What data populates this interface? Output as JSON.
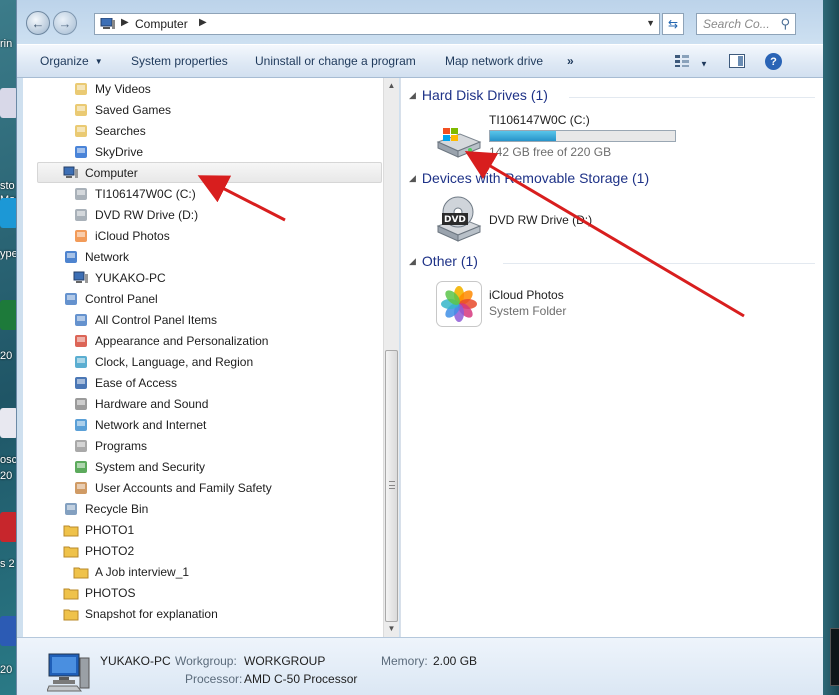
{
  "window": {
    "address": {
      "crumb": "Computer"
    },
    "search": {
      "placeholder": "Search Co..."
    }
  },
  "toolbar": {
    "organize": "Organize",
    "system_properties": "System properties",
    "uninstall": "Uninstall or change a program",
    "map_drive": "Map network drive",
    "more": "»"
  },
  "nav": [
    {
      "label": "My Videos",
      "icon": "videos-folder-icon"
    },
    {
      "label": "Saved Games",
      "icon": "saved-games-icon"
    },
    {
      "label": "Searches",
      "icon": "searches-icon"
    },
    {
      "label": "SkyDrive",
      "icon": "skydrive-icon"
    },
    {
      "label": "Computer",
      "icon": "computer-icon",
      "selected": true
    },
    {
      "label": "TI106147W0C (C:)",
      "icon": "hard-drive-icon"
    },
    {
      "label": "DVD RW Drive (D:)",
      "icon": "dvd-drive-icon"
    },
    {
      "label": "iCloud Photos",
      "icon": "icloud-photos-icon"
    },
    {
      "label": "Network",
      "icon": "network-icon"
    },
    {
      "label": "YUKAKO-PC",
      "icon": "computer-icon"
    },
    {
      "label": "Control Panel",
      "icon": "control-panel-icon"
    },
    {
      "label": "All Control Panel Items",
      "icon": "control-panel-icon"
    },
    {
      "label": "Appearance and Personalization",
      "icon": "appearance-icon"
    },
    {
      "label": "Clock, Language, and Region",
      "icon": "clock-icon"
    },
    {
      "label": "Ease of Access",
      "icon": "ease-of-access-icon"
    },
    {
      "label": "Hardware and Sound",
      "icon": "hardware-icon"
    },
    {
      "label": "Network and Internet",
      "icon": "network-internet-icon"
    },
    {
      "label": "Programs",
      "icon": "programs-icon"
    },
    {
      "label": "System and Security",
      "icon": "security-icon"
    },
    {
      "label": "User Accounts and Family Safety",
      "icon": "user-accounts-icon"
    },
    {
      "label": "Recycle Bin",
      "icon": "recycle-bin-icon"
    },
    {
      "label": "PHOTO1",
      "icon": "folder-icon"
    },
    {
      "label": "PHOTO2",
      "icon": "folder-icon"
    },
    {
      "label": "A Job interview_1",
      "icon": "folder-icon"
    },
    {
      "label": "PHOTOS",
      "icon": "folder-icon"
    },
    {
      "label": "Snapshot for explanation",
      "icon": "folder-icon"
    }
  ],
  "groups": {
    "hdd": "Hard Disk Drives (1)",
    "removable": "Devices with Removable Storage (1)",
    "other": "Other (1)"
  },
  "items": {
    "c_drive": {
      "name": "TI106147W0C (C:)",
      "free": "142 GB free of 220 GB",
      "used_fraction": 0.355
    },
    "d_drive": {
      "name": "DVD RW Drive (D:)"
    },
    "icloud": {
      "name": "iCloud Photos",
      "type": "System Folder"
    }
  },
  "details": {
    "pc_name": "YUKAKO-PC",
    "workgroup_label": "Workgroup:",
    "workgroup": "WORKGROUP",
    "memory_label": "Memory:",
    "memory": "2.00 GB",
    "processor_label": "Processor:",
    "processor": "AMD C-50 Processor"
  },
  "desktop": {
    "labels": [
      "rin",
      "sto",
      "Mar",
      "ype",
      "20",
      "osc",
      "20",
      "s 2",
      "20"
    ]
  },
  "colors": {
    "group_header": "#1e3287",
    "arrow": "#d81e1e",
    "drive_bar": "#2793c9"
  }
}
